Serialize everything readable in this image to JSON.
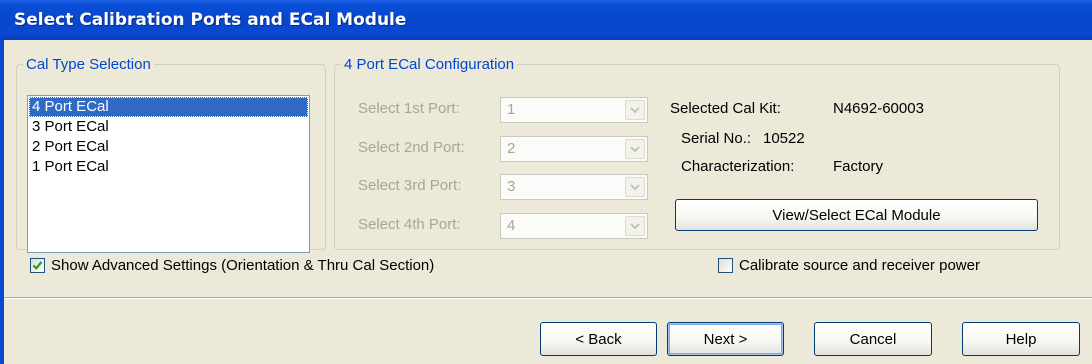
{
  "window": {
    "title": "Select Calibration Ports and ECal Module"
  },
  "cal_type": {
    "legend": "Cal Type Selection",
    "items": [
      "4 Port ECal",
      "3 Port ECal",
      "2 Port ECal",
      "1 Port ECal"
    ],
    "selected_index": 0
  },
  "config": {
    "legend": "4 Port ECal Configuration",
    "ports": [
      {
        "label": "Select 1st Port:",
        "value": "1"
      },
      {
        "label": "Select 2nd Port:",
        "value": "2"
      },
      {
        "label": "Select 3rd Port:",
        "value": "3"
      },
      {
        "label": "Select 4th Port:",
        "value": "4"
      }
    ],
    "selected_cal_kit_label": "Selected Cal Kit:",
    "selected_cal_kit_value": "N4692-60003",
    "serial_label": "Serial No.:",
    "serial_value": "10522",
    "characterization_label": "Characterization:",
    "characterization_value": "Factory",
    "view_select_button": "View/Select ECal Module"
  },
  "options": {
    "show_advanced_label": "Show Advanced Settings (Orientation & Thru Cal Section)",
    "show_advanced_checked": true,
    "calibrate_power_label": "Calibrate source and receiver power",
    "calibrate_power_checked": false
  },
  "buttons": {
    "back": "< Back",
    "next": "Next >",
    "cancel": "Cancel",
    "help": "Help"
  },
  "colors": {
    "title_bar": "#0746cc",
    "group_legend": "#0046d5",
    "selection": "#316ac5",
    "dialog_bg": "#ece9d8",
    "disabled_text": "#a7a697"
  }
}
